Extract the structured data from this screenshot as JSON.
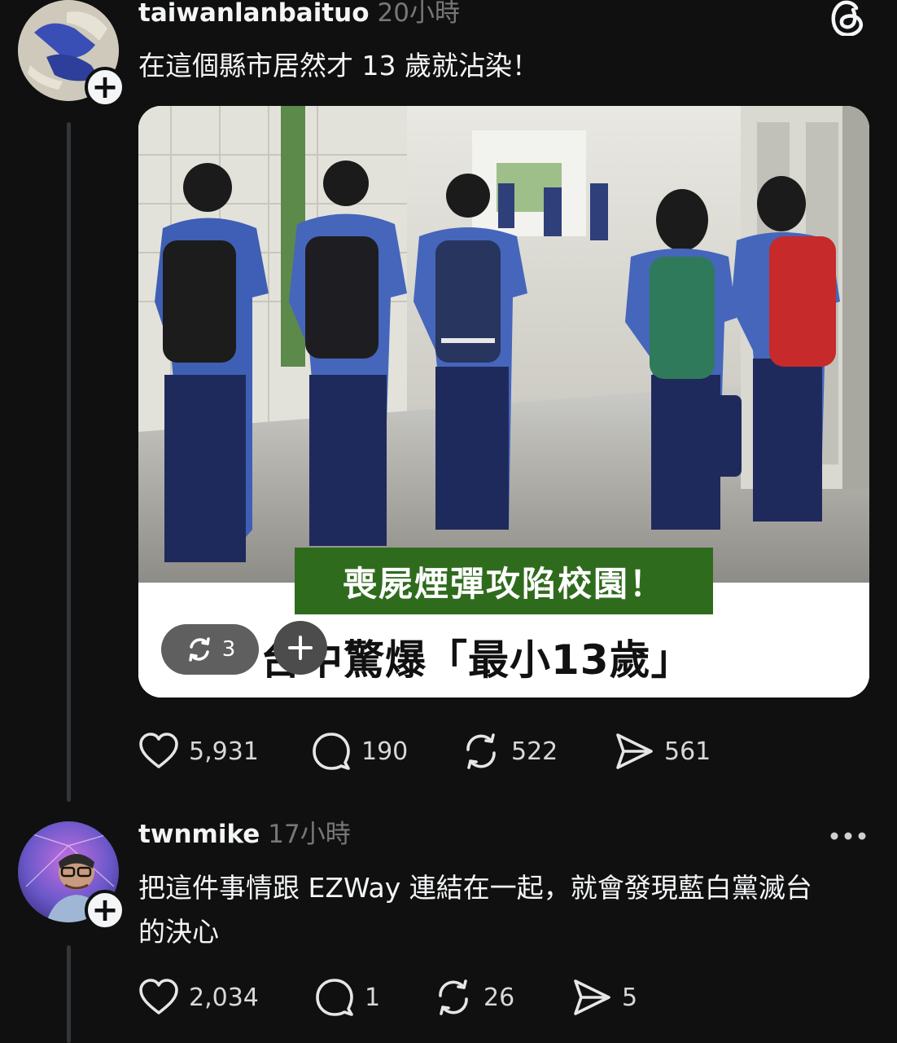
{
  "post1": {
    "username": "taiwanlanbaituo",
    "time": "20小時",
    "text": "在這個縣市居然才 13 歲就沾染！",
    "image": {
      "banner_text": "喪屍煙彈攻陷校園！",
      "headline_text": "台中驚爆「最小13歲」",
      "repost_count": "3"
    },
    "actions": {
      "likes": "5,931",
      "replies": "190",
      "reposts": "522",
      "shares": "561"
    }
  },
  "post2": {
    "username": "twnmike",
    "time": "17小時",
    "text_line1": "把這件事情跟 EZWay 連結在一起，就會發現藍白黨滅台",
    "text_line2": "的決心",
    "actions": {
      "likes": "2,034",
      "replies": "1",
      "reposts": "26",
      "shares": "5"
    }
  },
  "colors": {
    "background": "#101010",
    "text": "#f3f5f7",
    "muted": "#777777",
    "banner_green": "#2f6b1d"
  },
  "icons": [
    "threads-logo-icon",
    "heart-icon",
    "comment-icon",
    "repost-icon",
    "share-icon",
    "more-icon",
    "plus-icon"
  ]
}
